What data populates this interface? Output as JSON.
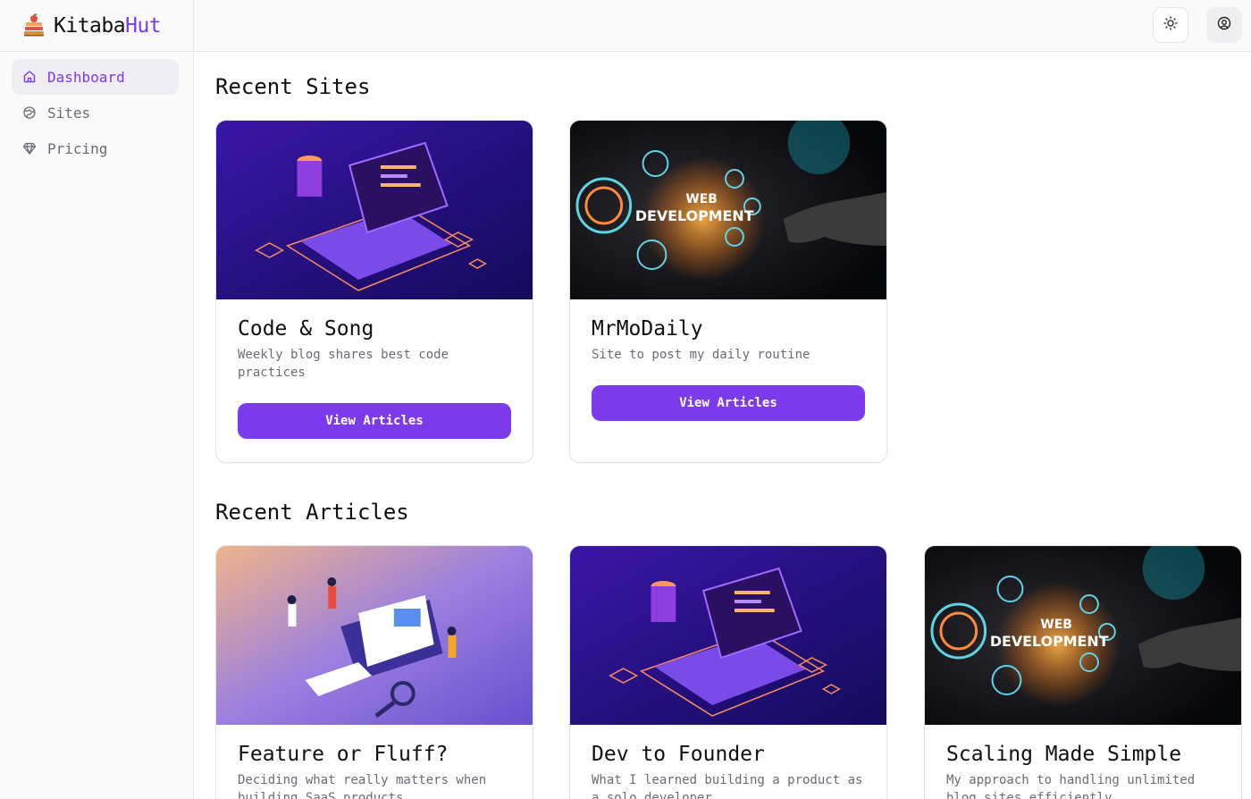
{
  "brand": {
    "name_main": "Kitaba",
    "name_accent": "Hut",
    "accent_color": "#7c3aed"
  },
  "sidebar": {
    "items": [
      {
        "label": "Dashboard",
        "icon": "home-icon",
        "active": true
      },
      {
        "label": "Sites",
        "icon": "globe-icon",
        "active": false
      },
      {
        "label": "Pricing",
        "icon": "diamond-icon",
        "active": false
      }
    ]
  },
  "header": {
    "theme_toggle_icon": "sun-icon",
    "user_menu_icon": "user-circle-icon"
  },
  "recent_sites": {
    "title": "Recent Sites",
    "cards": [
      {
        "title": "Code & Song",
        "description": "Weekly blog shares best code practices",
        "button": "View Articles",
        "image": "laptop-illustration"
      },
      {
        "title": "MrMoDaily",
        "description": "Site to post my daily routine",
        "button": "View Articles",
        "image": "web-development-illustration",
        "image_text_1": "WEB",
        "image_text_2": "DEVELOPMENT"
      }
    ]
  },
  "recent_articles": {
    "title": "Recent Articles",
    "cards": [
      {
        "title": "Feature or Fluff?",
        "description": "Deciding what really matters when building SaaS products",
        "image": "team-collaboration-illustration"
      },
      {
        "title": "Dev to Founder",
        "description": "What I learned building a product as a solo developer",
        "image": "laptop-illustration"
      },
      {
        "title": "Scaling Made Simple",
        "description": "My approach to handling unlimited blog sites efficiently",
        "image": "web-development-illustration",
        "image_text_1": "WEB",
        "image_text_2": "DEVELOPMENT"
      }
    ]
  }
}
